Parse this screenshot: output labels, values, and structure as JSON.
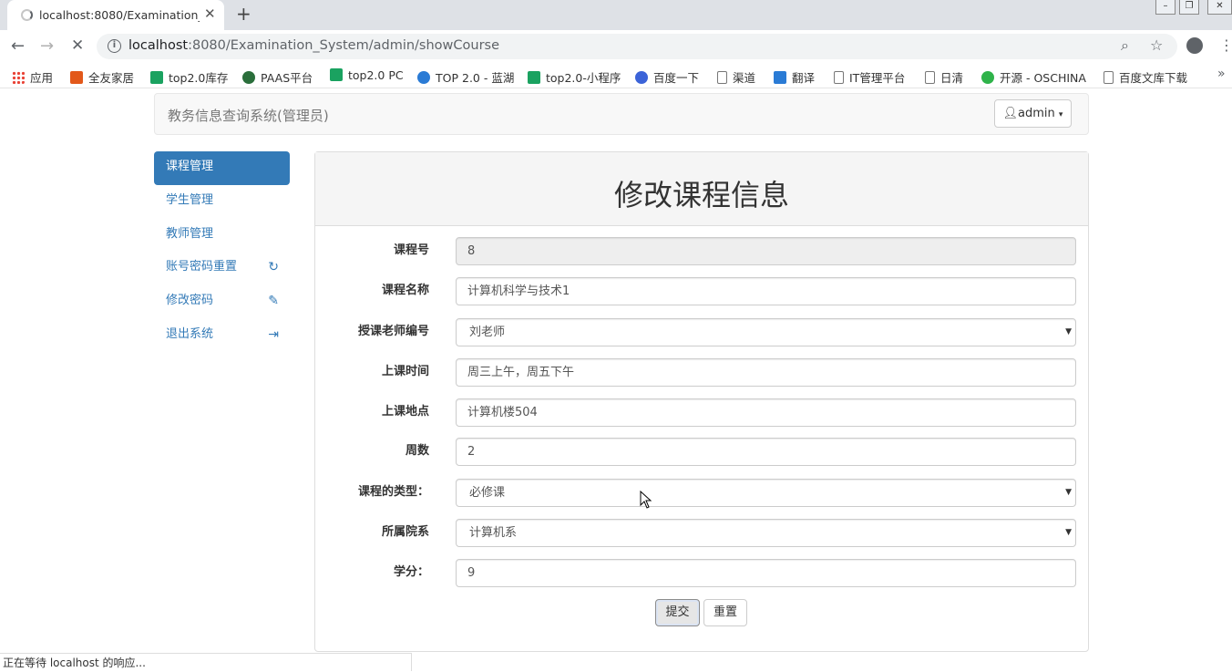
{
  "browser": {
    "tab_title": "localhost:8080/Examination_System/admin/showCourse",
    "tab_close": "✕",
    "new_tab": "+",
    "url_host": "localhost",
    "url_rest": ":8080/Examination_System/admin/showCourse",
    "bookmarks": [
      {
        "label": "应用",
        "icon": "apps-grid-icon",
        "color": "#e94235"
      },
      {
        "label": "全友家居",
        "icon": "u-logo-icon",
        "color": "#e2581a"
      },
      {
        "label": "top2.0库存",
        "icon": "play-icon",
        "color": "#1aa260"
      },
      {
        "label": "PAAS平台",
        "icon": "globe-icon",
        "color": "#2a6e3b"
      },
      {
        "label": "top2.0 PC",
        "icon": "play-icon",
        "color": "#1aa260"
      },
      {
        "label": "TOP 2.0 - 蓝湖",
        "icon": "lanhu-icon",
        "color": "#2a7bd5"
      },
      {
        "label": "top2.0-小程序",
        "icon": "play-icon",
        "color": "#1aa260"
      },
      {
        "label": "百度一下",
        "icon": "baidu-paw-icon",
        "color": "#3b63d8"
      },
      {
        "label": "渠道",
        "icon": "page-icon",
        "color": "#ffffff"
      },
      {
        "label": "翻译",
        "icon": "translate-icon",
        "color": "#2a7bd5"
      },
      {
        "label": "IT管理平台",
        "icon": "page-icon",
        "color": "#ffffff"
      },
      {
        "label": "日清",
        "icon": "page-icon",
        "color": "#ffffff"
      },
      {
        "label": "开源 - OSCHINA",
        "icon": "oschina-icon",
        "color": "#2fb34a"
      },
      {
        "label": "百度文库下载",
        "icon": "page-icon",
        "color": "#ffffff"
      }
    ],
    "status_text": "正在等待 localhost 的响应..."
  },
  "navbar": {
    "brand": "教务信息查询系统(管理员)",
    "user_label": "admin"
  },
  "sidebar": {
    "items": [
      {
        "label": "课程管理",
        "active": true
      },
      {
        "label": "学生管理"
      },
      {
        "label": "教师管理"
      },
      {
        "label": "账号密码重置",
        "icon": "refresh-icon"
      },
      {
        "label": "修改密码",
        "icon": "pencil-icon"
      },
      {
        "label": "退出系统",
        "icon": "logout-icon"
      }
    ]
  },
  "form": {
    "title": "修改课程信息",
    "fields": [
      {
        "label": "课程号",
        "value": "8"
      },
      {
        "label": "课程名称",
        "value": "计算机科学与技术1"
      },
      {
        "label": "授课老师编号",
        "value": "刘老师"
      },
      {
        "label": "上课时间",
        "value": "周三上午，周五下午"
      },
      {
        "label": "上课地点",
        "value": "计算机楼504"
      },
      {
        "label": "周数",
        "value": "2"
      },
      {
        "label": "课程的类型：",
        "value": "必修课"
      },
      {
        "label": "所属院系",
        "value": "计算机系"
      },
      {
        "label": "学分：",
        "value": "9"
      }
    ],
    "submit_label": "提交",
    "reset_label": "重置"
  }
}
